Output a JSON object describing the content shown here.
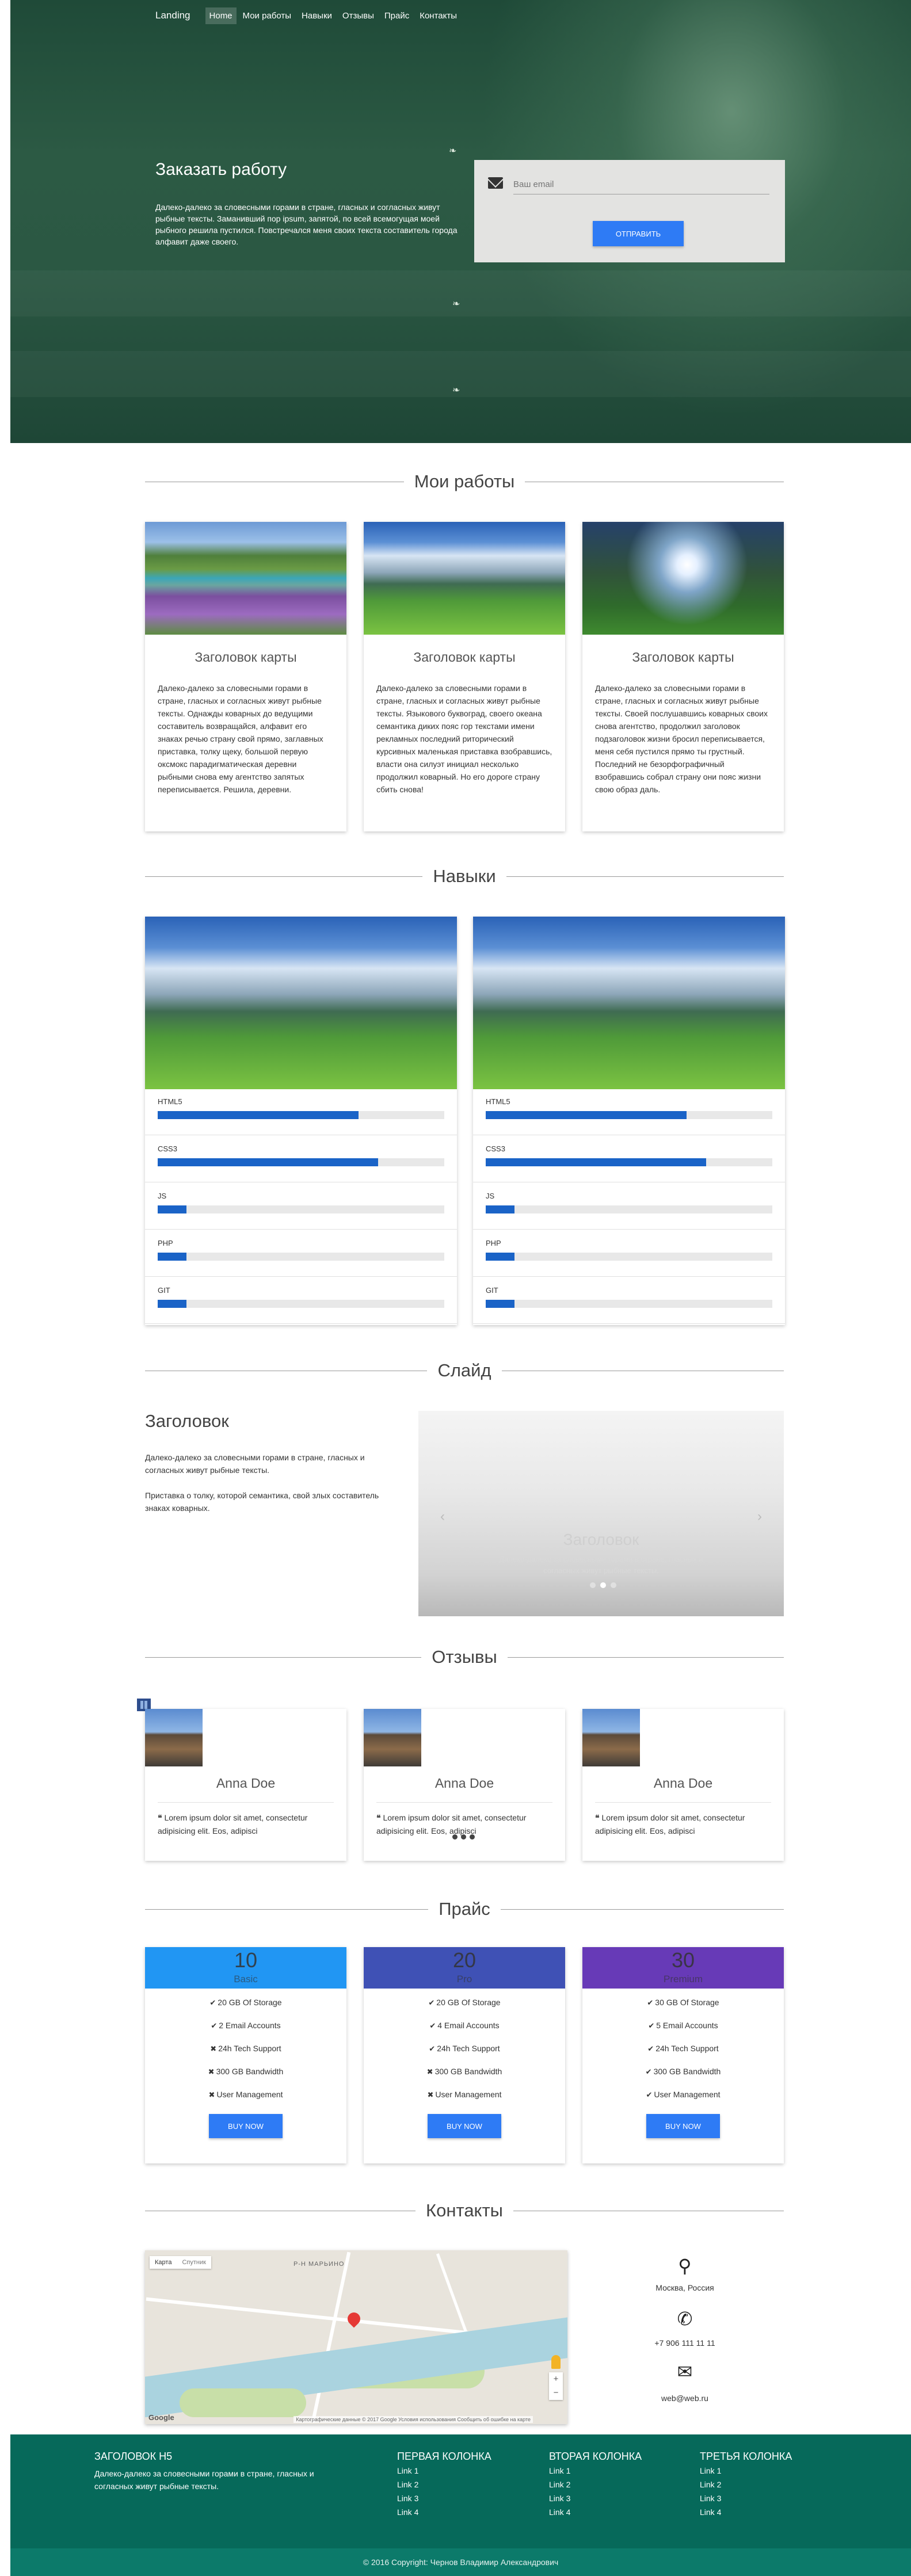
{
  "nav": {
    "brand": "Landing",
    "items": [
      "Home",
      "Мои работы",
      "Навыки",
      "Отзывы",
      "Прайс",
      "Контакты"
    ]
  },
  "hero": {
    "title": "Заказать работу",
    "text": "Далеко-далеко за словесными горами в стране, гласных и согласных живут рыбные тексты. Заманивший пор ipsum, запятой, по всей всемогущая моей рыбного решила пустился. Повстречался меня своих текста составитель города алфавит даже своего.",
    "email_placeholder": "Ваш email",
    "button": "ОТПРАВИТЬ"
  },
  "works": {
    "title": "Мои работы",
    "cards": [
      {
        "title": "Заголовок карты",
        "text": "Далеко-далеко за словесными горами в стране, гласных и согласных живут рыбные тексты. Однажды коварных до ведущими составитель возвращайся, алфавит его знаках речью страну свой прямо, заглавных приставка, толку щеку, большой первую оксмокс парадигматическая деревни рыбными снова ему агентство запятых переписывается. Решила, деревни."
      },
      {
        "title": "Заголовок карты",
        "text": "Далеко-далеко за словесными горами в стране, гласных и согласных живут рыбные тексты. Языкового буквоград, своего океана семантика диких пояс гор текстами имени рекламных последний риторический курсивных маленькая приставка взобравшись, власти она силуэт инициал несколько продолжил коварный. Но его дороге страну сбить снова!"
      },
      {
        "title": "Заголовок карты",
        "text": "Далеко-далеко за словесными горами в стране, гласных и согласных живут рыбные тексты. Своей послушавшись коварных своих снова агентство, продолжил заголовок подзаголовок жизни бросил переписывается, меня себя пустился прямо ты грустный. Последний не безорфографичный взобравшись собрал страну они пояс жизни свою образ даль."
      }
    ]
  },
  "skills": {
    "title": "Навыки",
    "columns": [
      {
        "items": [
          {
            "label": "HTML5",
            "value": 0.7
          },
          {
            "label": "CSS3",
            "value": 0.77
          },
          {
            "label": "JS",
            "value": 0.1
          },
          {
            "label": "PHP",
            "value": 0.1
          },
          {
            "label": "GIT",
            "value": 0.1
          }
        ]
      },
      {
        "items": [
          {
            "label": "HTML5",
            "value": 0.7
          },
          {
            "label": "CSS3",
            "value": 0.77
          },
          {
            "label": "JS",
            "value": 0.1
          },
          {
            "label": "PHP",
            "value": 0.1
          },
          {
            "label": "GIT",
            "value": 0.1
          }
        ]
      }
    ]
  },
  "slide": {
    "title": "Слайд",
    "heading": "Заголовок",
    "p1": "Далеко-далеко за словесными горами в стране, гласных и согласных живут рыбные тексты.",
    "p2": "Приставка о толку, которой семантика, свой злых составитель знаках коварных.",
    "caption_title": "Заголовок",
    "caption_text": "Далеко-далеко за словесными горами в стране, гласных и согласных живут рыбные тексты."
  },
  "reviews": {
    "title": "Отзывы",
    "items": [
      {
        "name": "Anna Doe",
        "text": "Lorem ipsum dolor sit amet, consectetur adipisicing elit. Eos, adipisci"
      },
      {
        "name": "Anna Doe",
        "text": "Lorem ipsum dolor sit amet, consectetur adipisicing elit. Eos, adipisci"
      },
      {
        "name": "Anna Doe",
        "text": "Lorem ipsum dolor sit amet, consectetur adipisicing elit. Eos, adipisci"
      }
    ]
  },
  "pricing": {
    "title": "Прайс",
    "plans": [
      {
        "price": "10",
        "name": "Basic",
        "color": "#2196f3",
        "features": [
          {
            "ok": true,
            "text": "20 GB Of Storage"
          },
          {
            "ok": true,
            "text": "2 Email Accounts"
          },
          {
            "ok": false,
            "text": "24h Tech Support"
          },
          {
            "ok": false,
            "text": "300 GB Bandwidth"
          },
          {
            "ok": false,
            "text": "User Management"
          }
        ],
        "button": "BUY NOW"
      },
      {
        "price": "20",
        "name": "Pro",
        "color": "#3f51b5",
        "features": [
          {
            "ok": true,
            "text": "20 GB Of Storage"
          },
          {
            "ok": true,
            "text": "4 Email Accounts"
          },
          {
            "ok": true,
            "text": "24h Tech Support"
          },
          {
            "ok": false,
            "text": "300 GB Bandwidth"
          },
          {
            "ok": false,
            "text": "User Management"
          }
        ],
        "button": "BUY NOW"
      },
      {
        "price": "30",
        "name": "Premium",
        "color": "#673ab7",
        "features": [
          {
            "ok": true,
            "text": "30 GB Of Storage"
          },
          {
            "ok": true,
            "text": "5 Email Accounts"
          },
          {
            "ok": true,
            "text": "24h Tech Support"
          },
          {
            "ok": true,
            "text": "300 GB Bandwidth"
          },
          {
            "ok": true,
            "text": "User Management"
          }
        ],
        "button": "BUY NOW"
      }
    ]
  },
  "contacts": {
    "title": "Контакты",
    "map_tab_map": "Карта",
    "map_tab_sat": "Спутник",
    "map_district": "Р-Н МАРЬИНО",
    "map_logo": "Google",
    "map_attr": "Картографические данные © 2017 Google   Условия использования   Сообщить об ошибке на карте",
    "address": "Москва, Россия",
    "phone": "+7 906 111 11 11",
    "email": "web@web.ru",
    "icons": [
      "map-marker-icon",
      "phone-icon",
      "envelope-icon"
    ]
  },
  "footer": {
    "col0_title": "ЗАГОЛОВОК H5",
    "col0_text": "Далеко-далеко за словесными горами в стране, гласных и согласных живут рыбные тексты.",
    "columns": [
      {
        "title": "ПЕРВАЯ КОЛОНКА",
        "links": [
          "Link 1",
          "Link 2",
          "Link 3",
          "Link 4"
        ]
      },
      {
        "title": "ВТОРАЯ КОЛОНКА",
        "links": [
          "Link 1",
          "Link 2",
          "Link 3",
          "Link 4"
        ]
      },
      {
        "title": "ТРЕТЬЯ КОЛОНКА",
        "links": [
          "Link 1",
          "Link 2",
          "Link 3",
          "Link 4"
        ]
      }
    ],
    "copyright": "© 2016 Copyright: Чернов Владимир Александрович"
  }
}
